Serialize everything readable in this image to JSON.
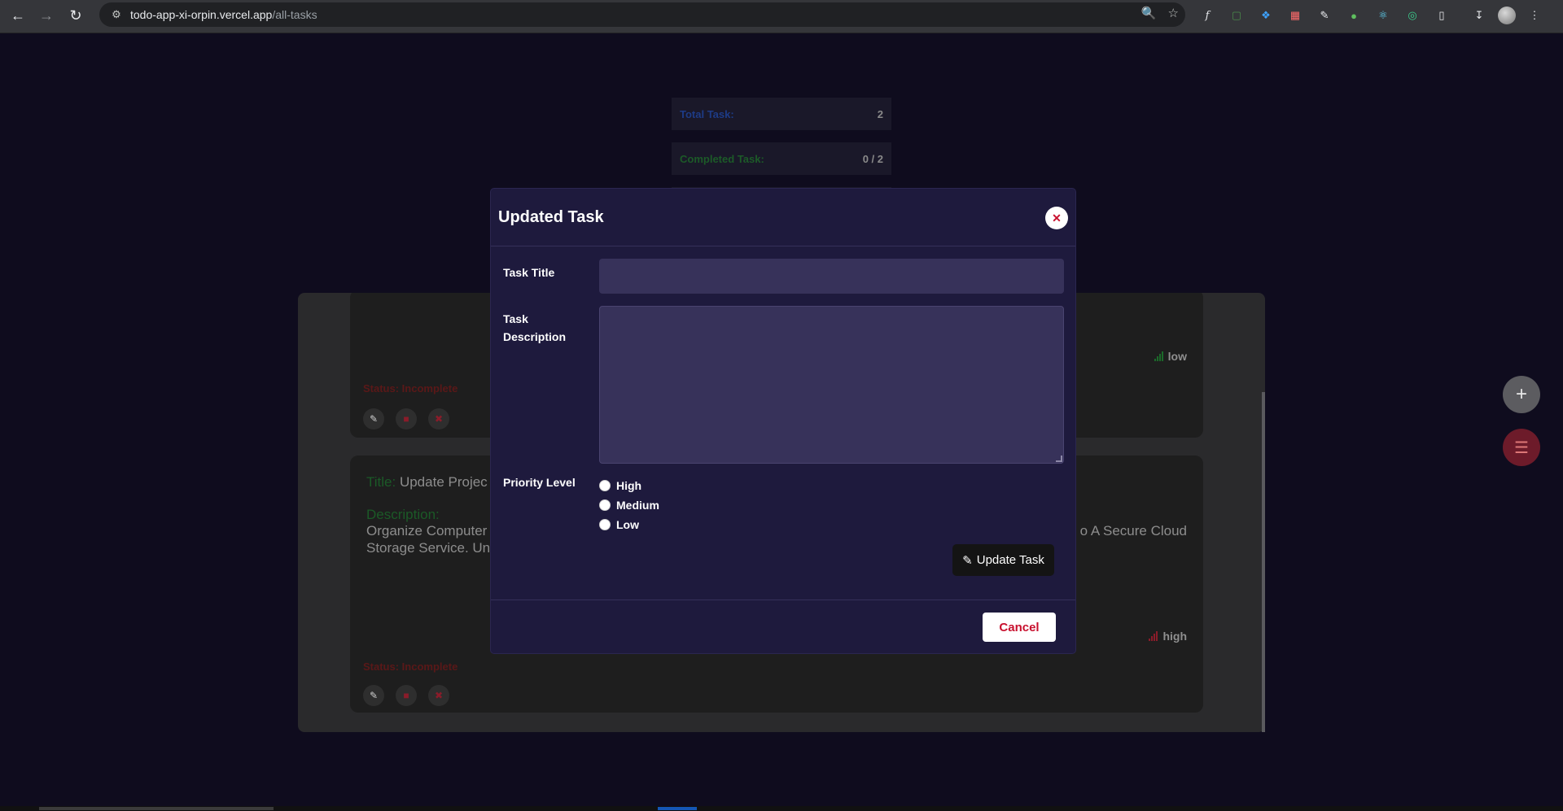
{
  "browser": {
    "url_host": "todo-app-xi-orpin.vercel.app",
    "url_path": "/all-tasks"
  },
  "stats": {
    "total_label": "Total Task:",
    "total_value": "2",
    "completed_label": "Completed Task:",
    "completed_value": "0 / 2"
  },
  "tasks": [
    {
      "priority": "low",
      "status": "Status: Incomplete"
    },
    {
      "title_label": "Title:",
      "title_visible": "Update Projec",
      "description_label": "Description:",
      "description_line1_left": "Organize Computer",
      "description_line1_right": "o A Secure Cloud",
      "description_line2_left": "Storage Service. Un",
      "priority": "high",
      "status": "Status: Incomplete"
    }
  ],
  "modal": {
    "title": "Updated Task",
    "task_title_label": "Task Title",
    "task_title_value": "",
    "task_description_label_1": "Task",
    "task_description_label_2": "Description",
    "task_description_value": "",
    "priority_label": "Priority Level",
    "priority_options": [
      "High",
      "Medium",
      "Low"
    ],
    "update_button": "Update Task",
    "cancel_button": "Cancel"
  },
  "colors": {
    "modal_bg": "#1e1a3d",
    "input_bg": "#37325a",
    "cancel_text": "#c8102e"
  }
}
